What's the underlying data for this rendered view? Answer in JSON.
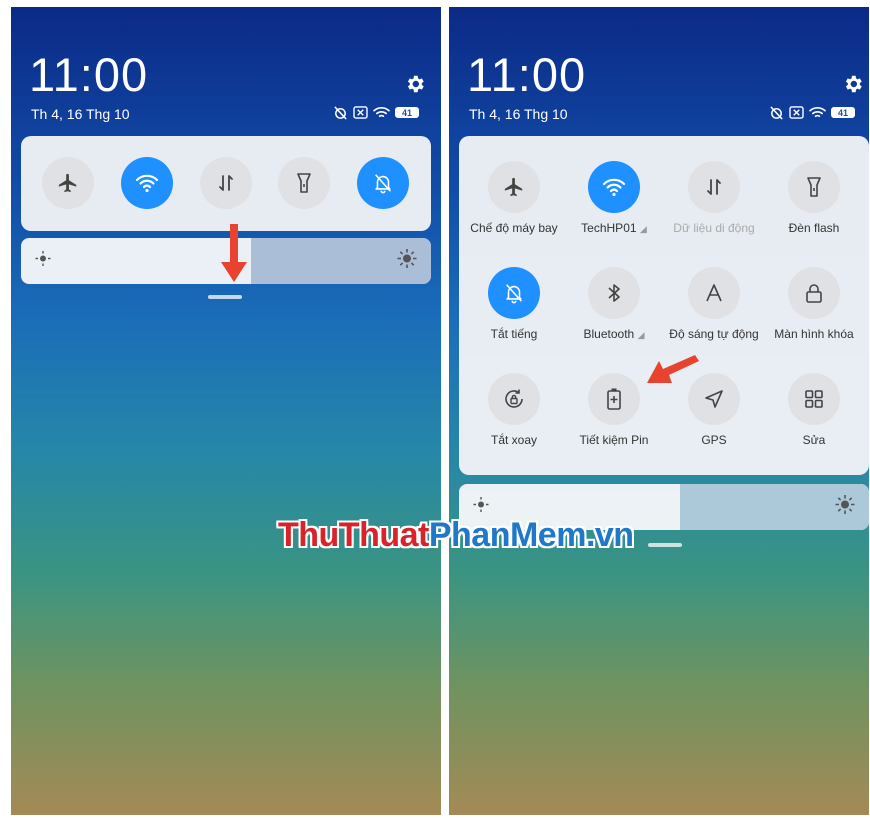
{
  "watermark": {
    "part1": "ThuThuat",
    "part2": "PhanMem",
    "part3": ".vn"
  },
  "left_screen": {
    "time": "11:00",
    "date": "Th 4, 16 Thg 10",
    "battery": "41",
    "toggles": [
      {
        "icon": "airplane-icon",
        "active": false
      },
      {
        "icon": "wifi-icon",
        "active": true
      },
      {
        "icon": "mobile-data-icon",
        "active": false
      },
      {
        "icon": "flashlight-icon",
        "active": false
      },
      {
        "icon": "silent-bell-icon",
        "active": true
      }
    ],
    "brightness_level": 0.56
  },
  "right_screen": {
    "time": "11:00",
    "date": "Th 4, 16 Thg 10",
    "battery": "41",
    "tiles": [
      {
        "label": "Chế độ máy bay",
        "icon": "airplane-icon",
        "active": false
      },
      {
        "label": "TechHP01",
        "icon": "wifi-icon",
        "active": true
      },
      {
        "label": "Dữ liệu di động",
        "icon": "mobile-data-icon",
        "active": false
      },
      {
        "label": "Đèn flash",
        "icon": "flashlight-icon",
        "active": false
      },
      {
        "label": "Tắt tiếng",
        "icon": "silent-bell-icon",
        "active": true
      },
      {
        "label": "Bluetooth",
        "icon": "bluetooth-icon",
        "active": false
      },
      {
        "label": "Độ sáng tự động",
        "icon": "auto-brightness-icon",
        "active": false
      },
      {
        "label": "Màn hình khóa",
        "icon": "lock-icon",
        "active": false
      },
      {
        "label": "Tắt xoay",
        "icon": "rotation-lock-icon",
        "active": false
      },
      {
        "label": "Tiết kiệm Pin",
        "icon": "battery-saver-icon",
        "active": false
      },
      {
        "label": "GPS",
        "icon": "gps-icon",
        "active": false
      },
      {
        "label": "Sửa",
        "icon": "edit-grid-icon",
        "active": false
      }
    ],
    "brightness_level": 0.54
  },
  "colors": {
    "accent": "#1e90ff",
    "annotation_arrow": "#e8432e"
  }
}
